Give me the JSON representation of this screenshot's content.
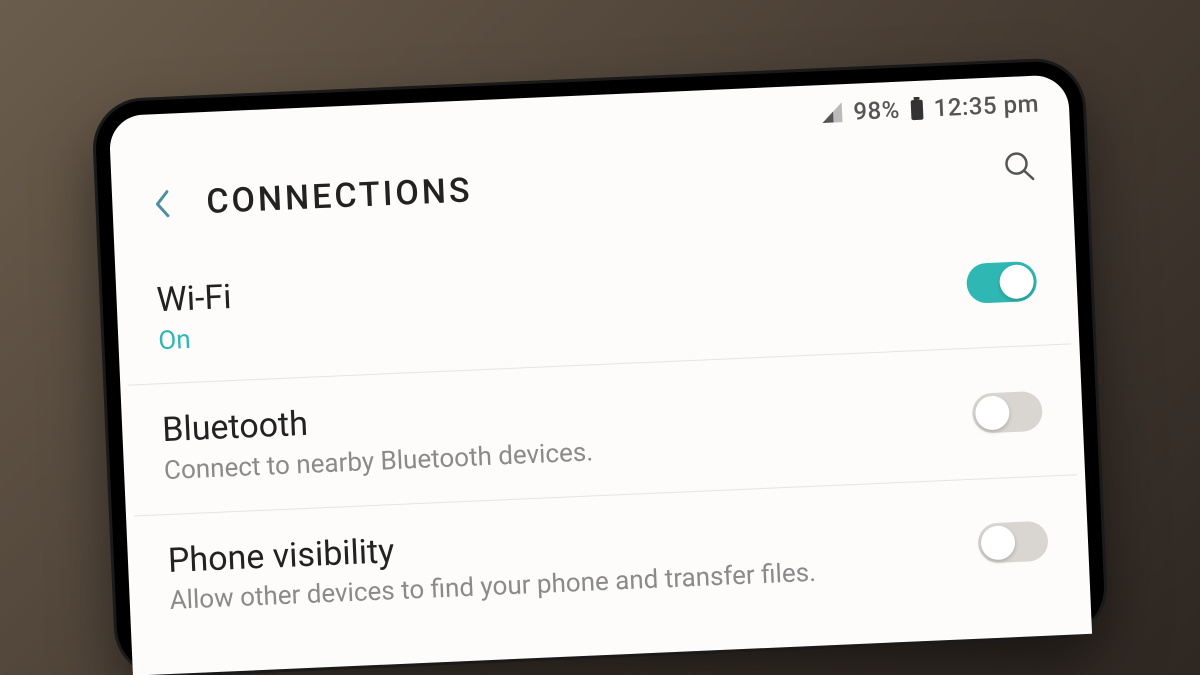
{
  "status": {
    "battery_pct": "98%",
    "time": "12:35 pm"
  },
  "header": {
    "title": "CONNECTIONS"
  },
  "items": [
    {
      "title": "Wi-Fi",
      "subtitle": "On",
      "enabled": true
    },
    {
      "title": "Bluetooth",
      "subtitle": "Connect to nearby Bluetooth devices.",
      "enabled": false
    },
    {
      "title": "Phone visibility",
      "subtitle": "Allow other devices to find your phone and transfer files.",
      "enabled": false
    }
  ]
}
